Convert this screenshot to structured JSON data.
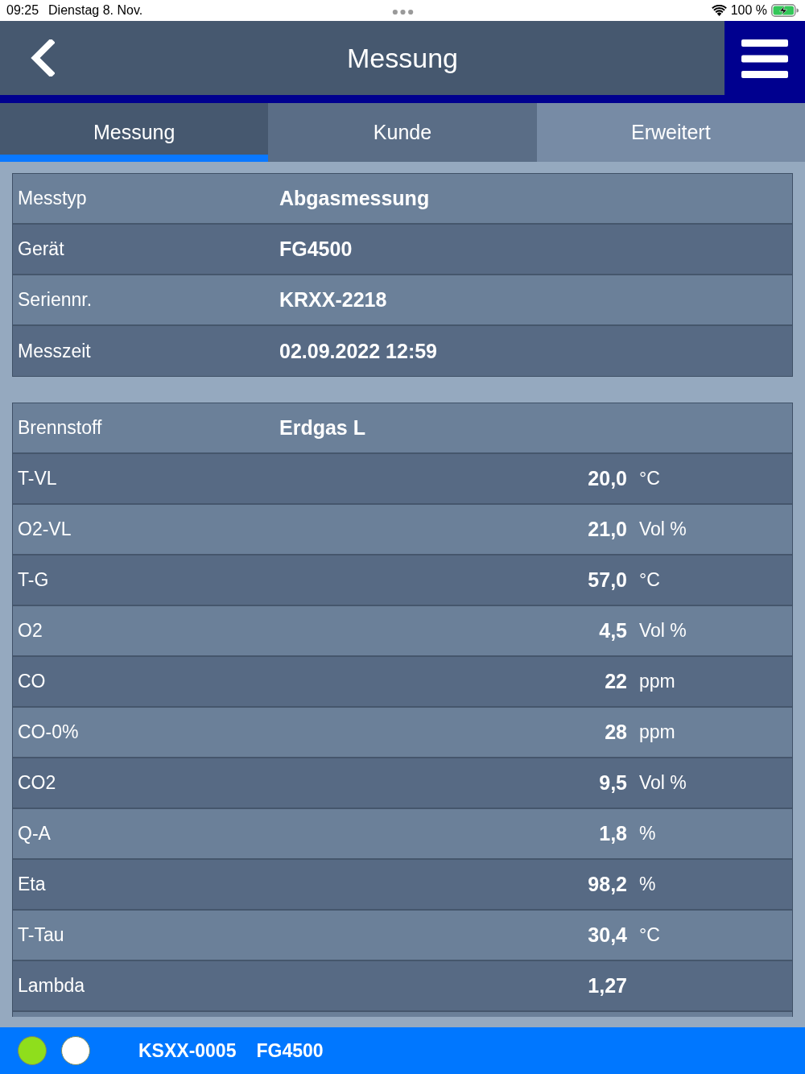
{
  "status_bar": {
    "time": "09:25",
    "date": "Dienstag 8. Nov.",
    "battery": "100 %"
  },
  "header": {
    "title": "Messung"
  },
  "tabs": [
    {
      "label": "Messung",
      "selected": true,
      "disabled": false
    },
    {
      "label": "Kunde",
      "selected": false,
      "disabled": false
    },
    {
      "label": "Erweitert",
      "selected": false,
      "disabled": true
    }
  ],
  "info_table": {
    "rows": [
      {
        "label": "Messtyp",
        "value": "Abgasmessung"
      },
      {
        "label": "Gerät",
        "value": "FG4500"
      },
      {
        "label": "Seriennr.",
        "value": "KRXX-2218"
      },
      {
        "label": "Messzeit",
        "value": "02.09.2022 12:59"
      }
    ]
  },
  "measurement_table": {
    "rows": [
      {
        "kind": "text",
        "label": "Brennstoff",
        "value": "Erdgas L"
      },
      {
        "kind": "reading",
        "label": "T-VL",
        "value": "20,0",
        "unit": "°C"
      },
      {
        "kind": "reading",
        "label": "O2-VL",
        "value": "21,0",
        "unit": "Vol %"
      },
      {
        "kind": "reading",
        "label": "T-G",
        "value": "57,0",
        "unit": "°C"
      },
      {
        "kind": "reading",
        "label": "O2",
        "value": "4,5",
        "unit": "Vol %"
      },
      {
        "kind": "reading",
        "label": "CO",
        "value": "22",
        "unit": "ppm"
      },
      {
        "kind": "reading",
        "label": "CO-0%",
        "value": "28",
        "unit": "ppm"
      },
      {
        "kind": "reading",
        "label": "CO2",
        "value": "9,5",
        "unit": "Vol %"
      },
      {
        "kind": "reading",
        "label": "Q-A",
        "value": "1,8",
        "unit": "%"
      },
      {
        "kind": "reading",
        "label": "Eta",
        "value": "98,2",
        "unit": "%"
      },
      {
        "kind": "reading",
        "label": "T-Tau",
        "value": "30,4",
        "unit": "°C"
      },
      {
        "kind": "reading",
        "label": "Lambda",
        "value": "1,27"
      }
    ]
  },
  "footer": {
    "indicators": [
      {
        "color": "#8fde1c"
      },
      {
        "color": "#ffffff"
      }
    ],
    "serial": "KSXX-0005",
    "device": "FG4500"
  }
}
